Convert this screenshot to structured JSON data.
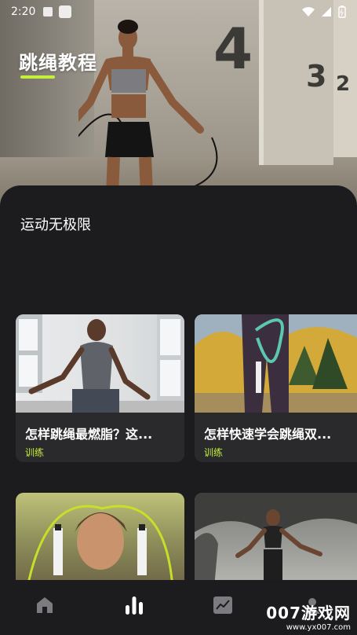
{
  "status_bar": {
    "time": "2:20"
  },
  "hero": {
    "title": "跳绳教程",
    "accent": "#c6ef3b"
  },
  "section": {
    "title": "运动无极限"
  },
  "cards": [
    {
      "title": "怎样跳绳最燃脂？这...",
      "tag": "训练"
    },
    {
      "title": "怎样快速学会跳绳双...",
      "tag": "训练"
    },
    {
      "title": "",
      "tag": ""
    },
    {
      "title": "",
      "tag": ""
    }
  ],
  "nav": [
    {
      "icon": "home-icon"
    },
    {
      "icon": "bar-chart-icon"
    },
    {
      "icon": "trend-chart-icon"
    },
    {
      "icon": "profile-icon"
    }
  ],
  "watermark": {
    "brand": "007游戏网",
    "url": "www.yx007.com"
  }
}
